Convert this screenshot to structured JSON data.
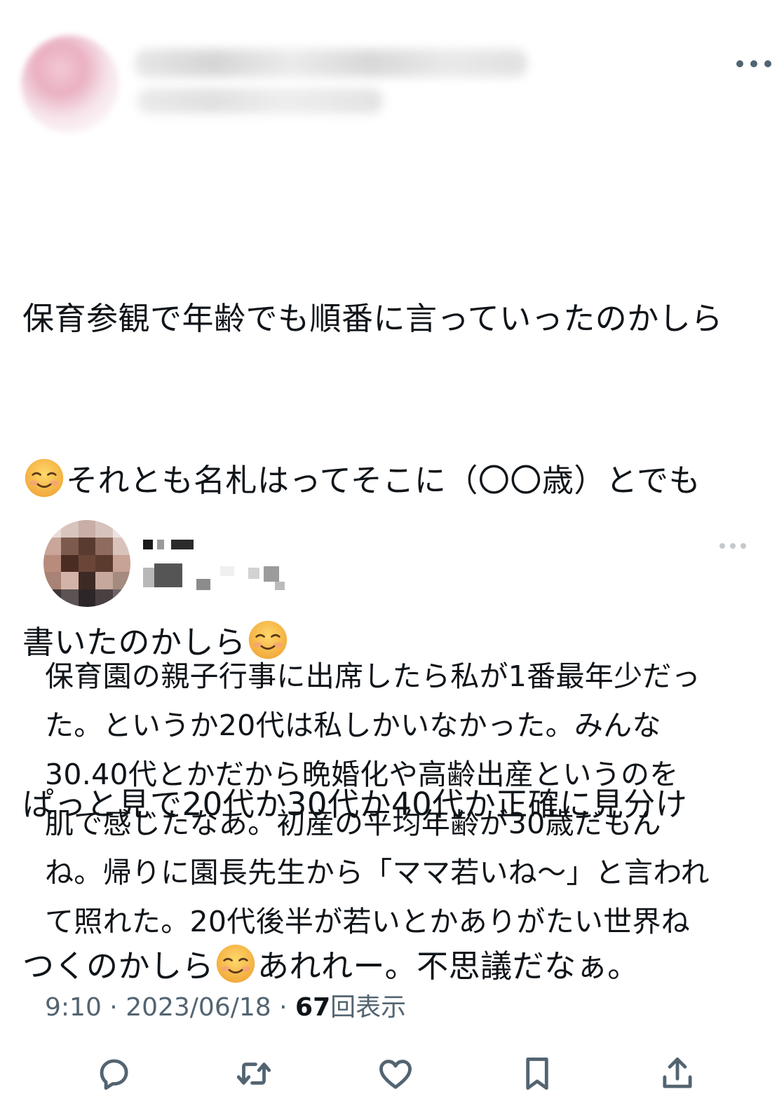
{
  "post": {
    "author_name": "",
    "author_handle": "",
    "lines": [
      [
        "保育参観で年齢でも順番に言っていったのかしら"
      ],
      [
        "{emoji}",
        "それとも名札はってそこに（〇〇歳）とでも"
      ],
      [
        "書いたのかしら",
        "{emoji}"
      ],
      [
        "ぱっと見で20代か30代か40代か正確に見分け"
      ],
      [
        "つくのかしら",
        "{emoji}",
        "あれれー。不思議だなぁ。"
      ]
    ],
    "text_line1": "保育参観で年齢でも順番に言っていったのかしら",
    "text_line2": "それとも名札はってそこに（〇〇歳）とでも",
    "text_line3": "書いたのかしら",
    "text_line4": "ぱっと見で20代か30代か40代か正確に見分け",
    "text_line5a": "つくのかしら",
    "text_line5b": "あれれー。不思議だなぁ。",
    "emoji": "smiling-face-icon"
  },
  "quote": {
    "author_name": "",
    "author_handle": "",
    "lines": [
      "保育園の親子行事に出席したら私が1番最年少だっ",
      "た。というか20代は私しかいなかった。みんな",
      "30.40代とかだから晩婚化や高齢出産というのを",
      "肌で感じたなあ。初産の平均年齢が30歳だもん",
      "ね。帰りに園長先生から「ママ若いね〜」と言われ",
      "て照れた。20代後半が若いとかありがたい世界ね"
    ]
  },
  "meta": {
    "time": "9:10",
    "separator": " · ",
    "date": "2023/06/18",
    "views_count": "67",
    "views_label": "回表示"
  },
  "actions": {
    "reply_icon": "reply-icon",
    "retweet_icon": "retweet-icon",
    "like_icon": "heart-icon",
    "bookmark_icon": "bookmark-icon",
    "share_icon": "share-icon"
  },
  "colors": {
    "text": "#0f1419",
    "secondary": "#536471",
    "emoji_face": "#f7c24a"
  }
}
